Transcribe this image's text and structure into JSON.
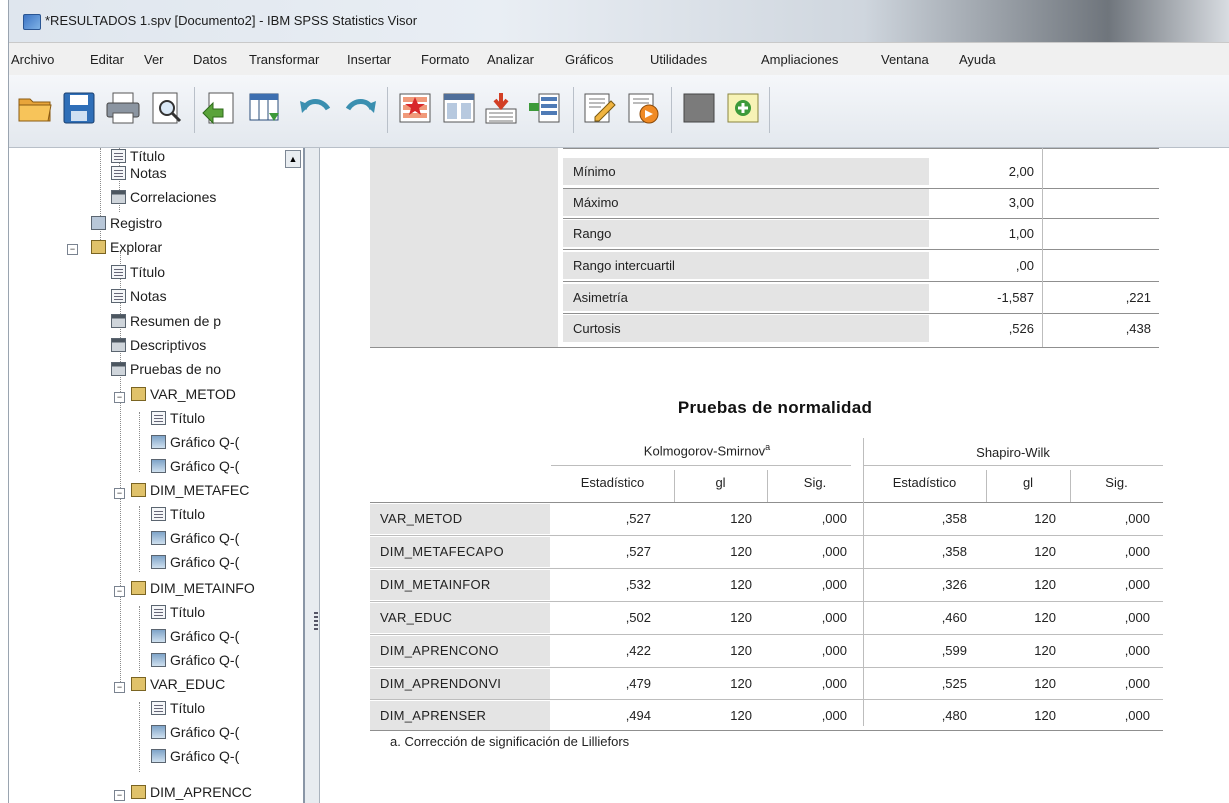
{
  "window": {
    "title": "*RESULTADOS 1.spv [Documento2] - IBM SPSS Statistics Visor"
  },
  "menu": [
    "Archivo",
    "Editar",
    "Ver",
    "Datos",
    "Transformar",
    "Insertar",
    "Formato",
    "Analizar",
    "Gráficos",
    "Utilidades",
    "Ampliaciones",
    "Ventana",
    "Ayuda"
  ],
  "toolbar": [
    "open-icon",
    "save-icon",
    "print-icon",
    "print-preview-icon",
    "export-icon",
    "goto-data-icon",
    "undo-icon",
    "redo-icon",
    "goto-case-icon",
    "goto-variable-icon",
    "insert-cases-icon",
    "insert-variables-icon",
    "edit-output-icon",
    "designate-window-icon",
    "hide-icon",
    "show-icon"
  ],
  "tree": {
    "items": [
      "Título",
      "Notas",
      "Correlaciones",
      "Registro",
      "Explorar",
      "Título",
      "Notas",
      "Resumen de p",
      "Descriptivos",
      "Pruebas de no",
      "VAR_METOD",
      "Título",
      "Gráfico Q-(",
      "Gráfico Q-(",
      "DIM_METAFEC",
      "Título",
      "Gráfico Q-(",
      "Gráfico Q-(",
      "DIM_METAINFO",
      "Título",
      "Gráfico Q-(",
      "Gráfico Q-(",
      "VAR_EDUC",
      "Título",
      "Gráfico Q-(",
      "Gráfico Q-(",
      "DIM_APRENCC"
    ]
  },
  "stats": {
    "rows": [
      {
        "label": "Mínimo",
        "value": "2,00",
        "se": ""
      },
      {
        "label": "Máximo",
        "value": "3,00",
        "se": ""
      },
      {
        "label": "Rango",
        "value": "1,00",
        "se": ""
      },
      {
        "label": "Rango intercuartil",
        "value": ",00",
        "se": ""
      },
      {
        "label": "Asimetría",
        "value": "-1,587",
        "se": ",221"
      },
      {
        "label": "Curtosis",
        "value": ",526",
        "se": ",438"
      }
    ]
  },
  "normality": {
    "title": "Pruebas de normalidad",
    "group1": "Kolmogorov-Smirnov",
    "group1_sup": "a",
    "group2": "Shapiro-Wilk",
    "columns": [
      "Estadístico",
      "gl",
      "Sig.",
      "Estadístico",
      "gl",
      "Sig."
    ],
    "rows": [
      {
        "label": "VAR_METOD",
        "cells": [
          ",527",
          "120",
          ",000",
          ",358",
          "120",
          ",000"
        ]
      },
      {
        "label": "DIM_METAFECAPO",
        "cells": [
          ",527",
          "120",
          ",000",
          ",358",
          "120",
          ",000"
        ]
      },
      {
        "label": "DIM_METAINFOR",
        "cells": [
          ",532",
          "120",
          ",000",
          ",326",
          "120",
          ",000"
        ]
      },
      {
        "label": "VAR_EDUC",
        "cells": [
          ",502",
          "120",
          ",000",
          ",460",
          "120",
          ",000"
        ]
      },
      {
        "label": "DIM_APRENCONO",
        "cells": [
          ",422",
          "120",
          ",000",
          ",599",
          "120",
          ",000"
        ]
      },
      {
        "label": "DIM_APRENDONVI",
        "cells": [
          ",479",
          "120",
          ",000",
          ",525",
          "120",
          ",000"
        ]
      },
      {
        "label": "DIM_APRENSER",
        "cells": [
          ",494",
          "120",
          ",000",
          ",480",
          "120",
          ",000"
        ]
      }
    ],
    "footnote": "a. Corrección de significación de Lilliefors"
  }
}
